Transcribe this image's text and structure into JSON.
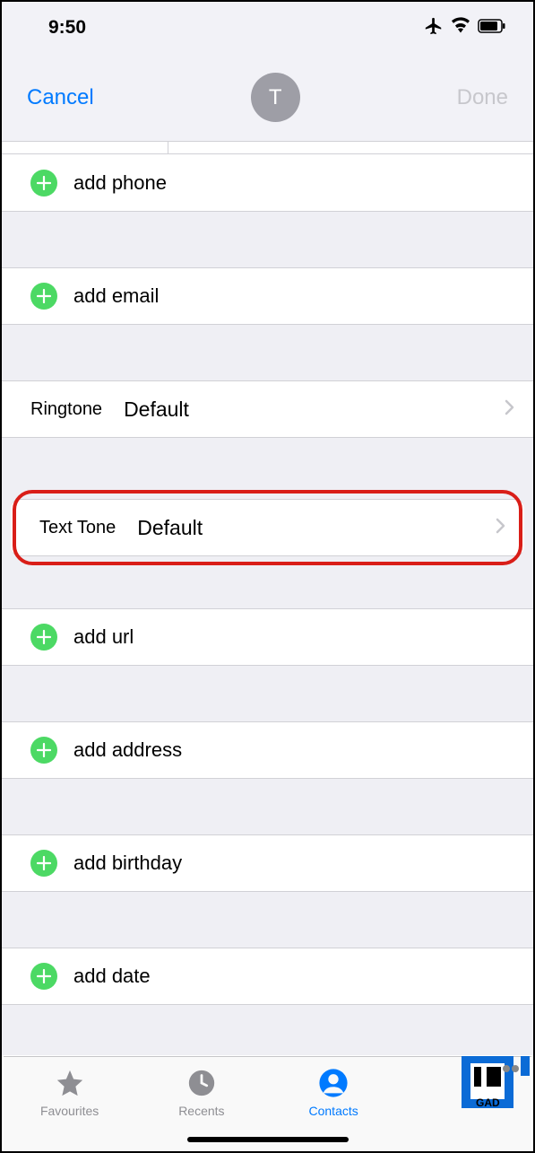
{
  "status": {
    "time": "9:50"
  },
  "header": {
    "cancel": "Cancel",
    "done": "Done",
    "avatar_initial": "T"
  },
  "rows": {
    "add_phone": "add phone",
    "add_email": "add email",
    "add_url": "add url",
    "add_address": "add address",
    "add_birthday": "add birthday",
    "add_date": "add date"
  },
  "ringtone": {
    "label": "Ringtone",
    "value": "Default"
  },
  "texttone": {
    "label": "Text Tone",
    "value": "Default"
  },
  "tabs": {
    "favourites": "Favourites",
    "recents": "Recents",
    "contacts": "Contacts"
  }
}
